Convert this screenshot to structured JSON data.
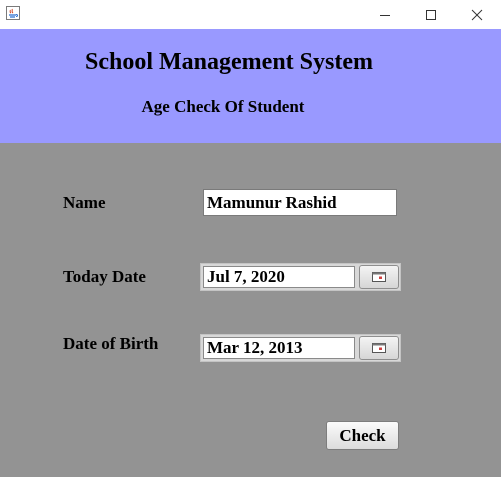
{
  "colors": {
    "header_bg": "#9999ff",
    "body_bg": "#939393"
  },
  "titlebar": {
    "app_icon": "java-icon",
    "minimize_icon": "minimize-icon",
    "maximize_icon": "maximize-icon",
    "close_icon": "close-icon"
  },
  "header": {
    "title": "School Management System",
    "subtitle": "Age Check Of Student"
  },
  "form": {
    "name_label": "Name",
    "name_value": "Mamunur Rashid",
    "today_label": "Today Date",
    "today_value": "Jul 7, 2020",
    "dob_label": "Date of Birth",
    "dob_value": "Mar 12, 2013",
    "calendar_icon": "calendar-icon",
    "check_button": "Check"
  }
}
